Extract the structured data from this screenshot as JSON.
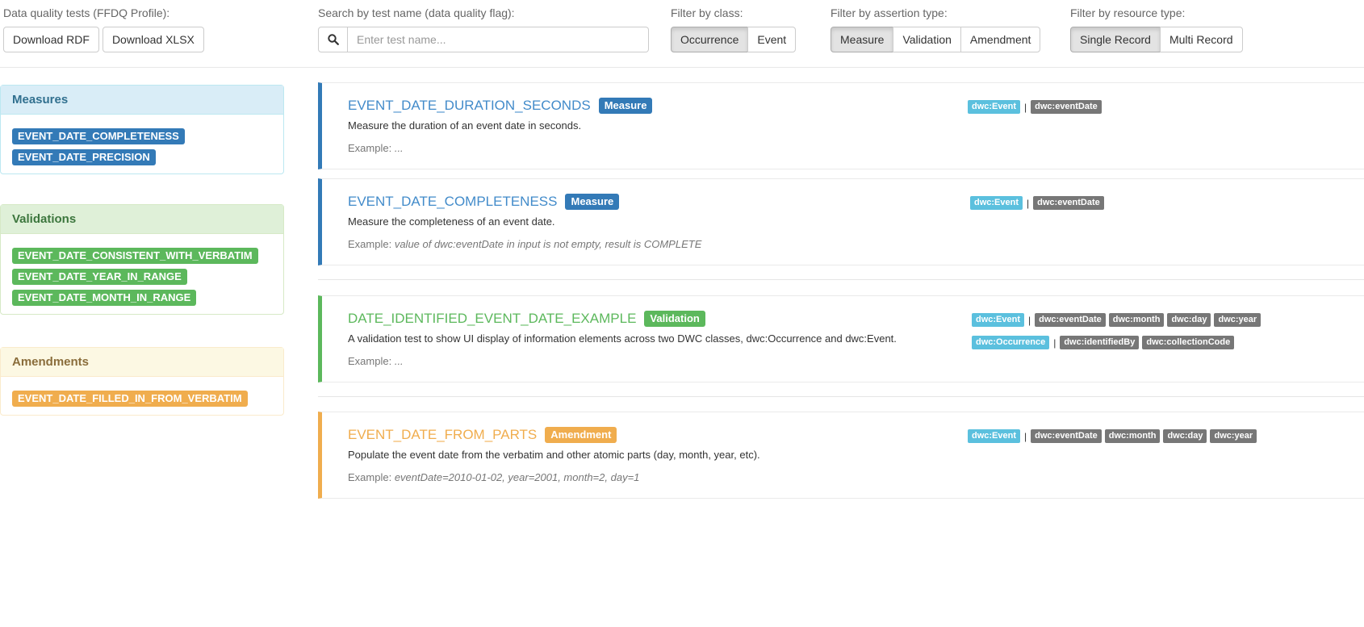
{
  "toolbar": {
    "profile_label": "Data quality tests (FFDQ Profile):",
    "download_rdf": "Download RDF",
    "download_xlsx": "Download XLSX",
    "search_label": "Search by test name (data quality flag):",
    "search_placeholder": "Enter test name...",
    "search_value": "",
    "class_label": "Filter by class:",
    "class_options": [
      "Occurrence",
      "Event"
    ],
    "class_active": "Occurrence",
    "assertion_label": "Filter by assertion type:",
    "assertion_options": [
      "Measure",
      "Validation",
      "Amendment"
    ],
    "assertion_active": "Measure",
    "resource_label": "Filter by resource type:",
    "resource_options": [
      "Single Record",
      "Multi Record"
    ],
    "resource_active": "Single Record"
  },
  "sidebar": {
    "measures": {
      "title": "Measures",
      "items": [
        "EVENT_DATE_COMPLETENESS",
        "EVENT_DATE_PRECISION"
      ]
    },
    "validations": {
      "title": "Validations",
      "items": [
        "EVENT_DATE_CONSISTENT_WITH_VERBATIM",
        "EVENT_DATE_YEAR_IN_RANGE",
        "EVENT_DATE_MONTH_IN_RANGE"
      ]
    },
    "amendments": {
      "title": "Amendments",
      "items": [
        "EVENT_DATE_FILLED_IN_FROM_VERBATIM"
      ]
    }
  },
  "cards": [
    {
      "name": "EVENT_DATE_DURATION_SECONDS",
      "type": "Measure",
      "description": "Measure the duration of an event date in seconds.",
      "example_label": "Example:",
      "example_value": "...",
      "tag_rows": [
        {
          "classes": [
            "dwc:Event"
          ],
          "elements": [
            "dwc:eventDate"
          ]
        }
      ]
    },
    {
      "name": "EVENT_DATE_COMPLETENESS",
      "type": "Measure",
      "description": "Measure the completeness of an event date.",
      "example_label": "Example:",
      "example_value": "value of dwc:eventDate in input is not empty, result is COMPLETE",
      "tag_rows": [
        {
          "classes": [
            "dwc:Event"
          ],
          "elements": [
            "dwc:eventDate"
          ]
        }
      ]
    },
    {
      "name": "DATE_IDENTIFIED_EVENT_DATE_EXAMPLE",
      "type": "Validation",
      "description": "A validation test to show UI display of information elements across two DWC classes, dwc:Occurrence and dwc:Event.",
      "example_label": "Example:",
      "example_value": "...",
      "tag_rows": [
        {
          "classes": [
            "dwc:Event"
          ],
          "elements": [
            "dwc:eventDate",
            "dwc:month",
            "dwc:day",
            "dwc:year"
          ]
        },
        {
          "classes": [
            "dwc:Occurrence"
          ],
          "elements": [
            "dwc:identifiedBy",
            "dwc:collectionCode"
          ]
        }
      ]
    },
    {
      "name": "EVENT_DATE_FROM_PARTS",
      "type": "Amendment",
      "description": "Populate the event date from the verbatim and other atomic parts (day, month, year, etc).",
      "example_label": "Example:",
      "example_value": "eventDate=2010-01-02, year=2001, month=2, day=1",
      "tag_rows": [
        {
          "classes": [
            "dwc:Event"
          ],
          "elements": [
            "dwc:eventDate",
            "dwc:month",
            "dwc:day",
            "dwc:year"
          ]
        }
      ]
    }
  ],
  "tag_separator": "|",
  "colors": {
    "measure": "#337ab7",
    "validation": "#5cb85c",
    "amendment": "#f0ad4e",
    "class_chip": "#5bc0de",
    "element_chip": "#777777"
  }
}
